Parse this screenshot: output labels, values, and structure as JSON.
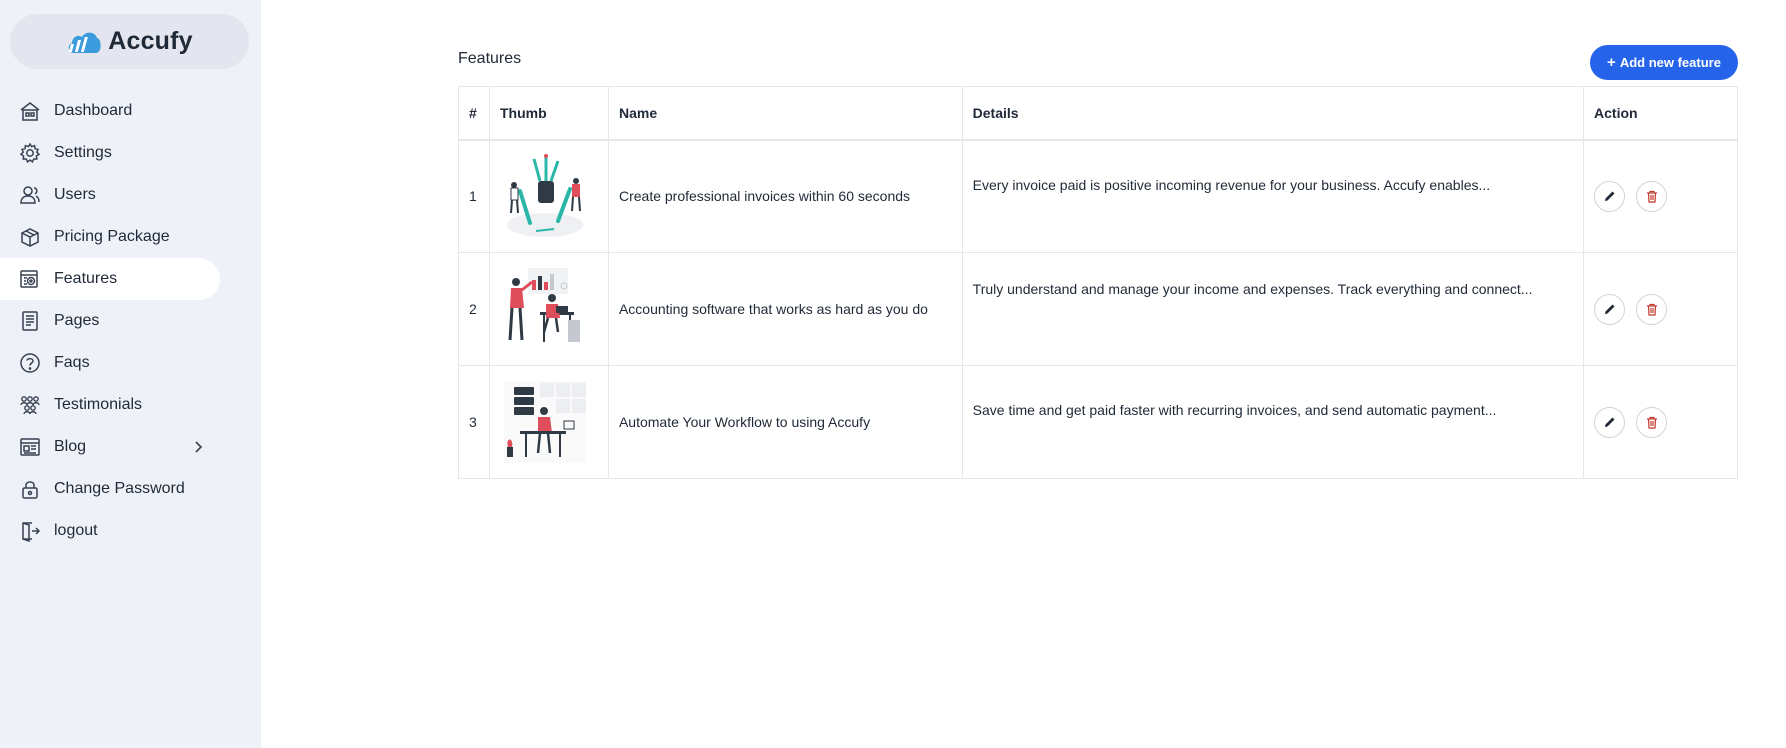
{
  "brand": {
    "name": "Accufy",
    "logo_icon": "accufy-cloud-logo-icon"
  },
  "sidebar": {
    "items": [
      {
        "label": "Dashboard",
        "icon": "dashboard-icon",
        "active": false
      },
      {
        "label": "Settings",
        "icon": "gear-icon",
        "active": false
      },
      {
        "label": "Users",
        "icon": "users-icon",
        "active": false
      },
      {
        "label": "Pricing Package",
        "icon": "package-icon",
        "active": false
      },
      {
        "label": "Features",
        "icon": "features-icon",
        "active": true
      },
      {
        "label": "Pages",
        "icon": "pages-icon",
        "active": false
      },
      {
        "label": "Faqs",
        "icon": "question-icon",
        "active": false
      },
      {
        "label": "Testimonials",
        "icon": "testimonials-icon",
        "active": false
      },
      {
        "label": "Blog",
        "icon": "blog-icon",
        "active": false,
        "has_submenu": true
      },
      {
        "label": "Change Password",
        "icon": "lock-icon",
        "active": false
      },
      {
        "label": "logout",
        "icon": "logout-icon",
        "active": false
      }
    ]
  },
  "main": {
    "title": "Features",
    "add_button_label": "Add new feature",
    "accent_color": "#2563eb"
  },
  "table": {
    "headers": {
      "num": "#",
      "thumb": "Thumb",
      "name": "Name",
      "details": "Details",
      "action": "Action"
    },
    "rows": [
      {
        "num": "1",
        "thumb": "invoice-illustration",
        "name": "Create professional invoices within 60 seconds",
        "details": "Every invoice paid is positive incoming revenue for your business. Accufy enables..."
      },
      {
        "num": "2",
        "thumb": "accounting-illustration",
        "name": "Accounting software that works as hard as you do",
        "details": "Truly understand and manage your income and expenses. Track everything and connect..."
      },
      {
        "num": "3",
        "thumb": "workflow-illustration",
        "name": "Automate Your Workflow to using Accufy",
        "details": "Save time and get paid faster with recurring invoices, and send automatic payment..."
      }
    ]
  }
}
